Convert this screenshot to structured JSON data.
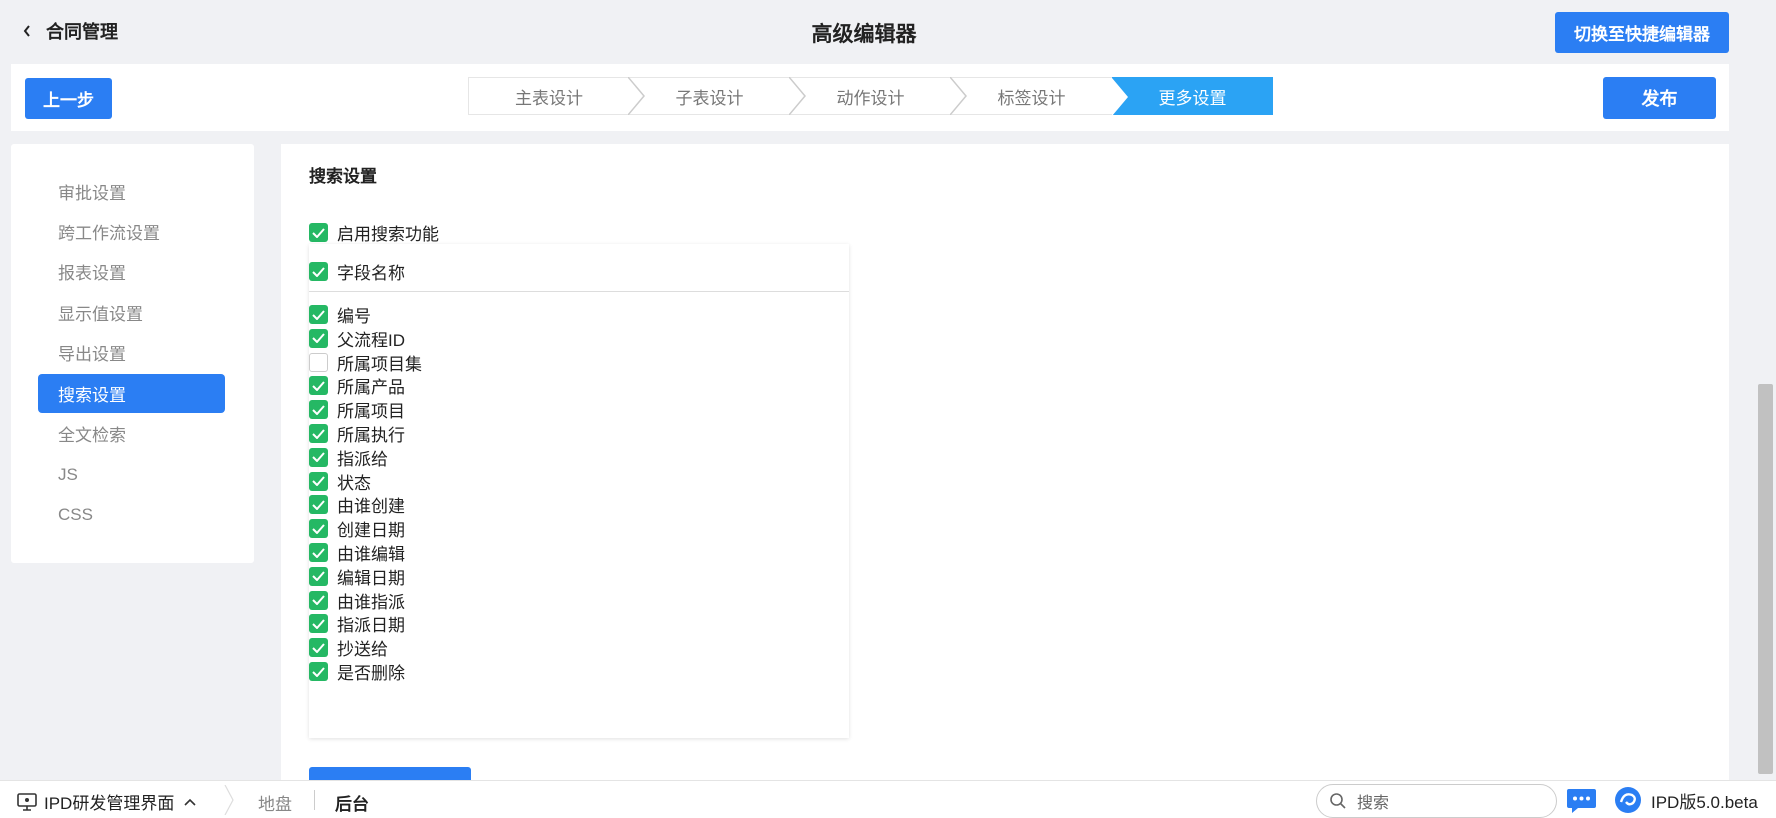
{
  "header": {
    "back_label": "合同管理",
    "title": "高级编辑器",
    "switch_label": "切换至快捷编辑器"
  },
  "stepbar": {
    "prev_label": "上一步",
    "publish_label": "发布",
    "steps": [
      {
        "label": "主表设计",
        "active": false
      },
      {
        "label": "子表设计",
        "active": false
      },
      {
        "label": "动作设计",
        "active": false
      },
      {
        "label": "标签设计",
        "active": false
      },
      {
        "label": "更多设置",
        "active": true
      }
    ]
  },
  "sidebar": {
    "items": [
      {
        "label": "审批设置",
        "active": false
      },
      {
        "label": "跨工作流设置",
        "active": false
      },
      {
        "label": "报表设置",
        "active": false
      },
      {
        "label": "显示值设置",
        "active": false
      },
      {
        "label": "导出设置",
        "active": false
      },
      {
        "label": "搜索设置",
        "active": true
      },
      {
        "label": "全文检索",
        "active": false
      },
      {
        "label": "JS",
        "active": false
      },
      {
        "label": "CSS",
        "active": false
      }
    ]
  },
  "search_settings": {
    "section_title": "搜索设置",
    "enable": {
      "label": "启用搜索功能",
      "checked": true
    },
    "header_field": {
      "label": "字段名称",
      "checked": true
    },
    "fields": [
      {
        "label": "编号",
        "checked": true
      },
      {
        "label": "父流程ID",
        "checked": true
      },
      {
        "label": "所属项目集",
        "checked": false
      },
      {
        "label": "所属产品",
        "checked": true
      },
      {
        "label": "所属项目",
        "checked": true
      },
      {
        "label": "所属执行",
        "checked": true
      },
      {
        "label": "指派给",
        "checked": true
      },
      {
        "label": "状态",
        "checked": true
      },
      {
        "label": "由谁创建",
        "checked": true
      },
      {
        "label": "创建日期",
        "checked": true
      },
      {
        "label": "由谁编辑",
        "checked": true
      },
      {
        "label": "编辑日期",
        "checked": true
      },
      {
        "label": "由谁指派",
        "checked": true
      },
      {
        "label": "指派日期",
        "checked": true
      },
      {
        "label": "抄送给",
        "checked": true
      },
      {
        "label": "是否删除",
        "checked": true
      }
    ]
  },
  "taskbar": {
    "app_label": "IPD研发管理界面",
    "crumb_1": "地盘",
    "crumb_2": "后台",
    "search_placeholder": "搜索",
    "version": "IPD版5.0.beta"
  },
  "colors": {
    "primary": "#2b7ef3",
    "step_active": "#2ba3f4",
    "checkbox_on": "#25b864"
  }
}
